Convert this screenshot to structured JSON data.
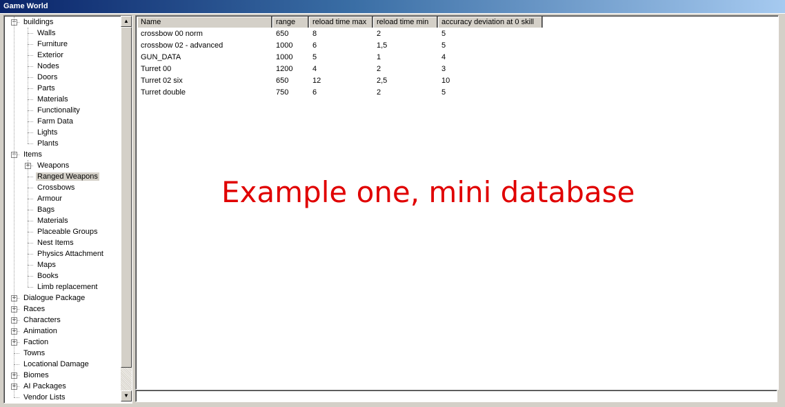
{
  "window": {
    "title": "Game World"
  },
  "tree": {
    "items": [
      {
        "label": "buildings",
        "level": 0,
        "expander": "minus"
      },
      {
        "label": "Walls",
        "level": 1
      },
      {
        "label": "Furniture",
        "level": 1
      },
      {
        "label": "Exterior",
        "level": 1
      },
      {
        "label": "Nodes",
        "level": 1
      },
      {
        "label": "Doors",
        "level": 1
      },
      {
        "label": "Parts",
        "level": 1
      },
      {
        "label": "Materials",
        "level": 1
      },
      {
        "label": "Functionality",
        "level": 1
      },
      {
        "label": "Farm Data",
        "level": 1
      },
      {
        "label": "Lights",
        "level": 1
      },
      {
        "label": "Plants",
        "level": 1
      },
      {
        "label": "Items",
        "level": 0,
        "expander": "minus"
      },
      {
        "label": "Weapons",
        "level": 1,
        "expander": "plus"
      },
      {
        "label": "Ranged Weapons",
        "level": 1,
        "selected": true
      },
      {
        "label": "Crossbows",
        "level": 1
      },
      {
        "label": "Armour",
        "level": 1
      },
      {
        "label": "Bags",
        "level": 1
      },
      {
        "label": "Materials",
        "level": 1
      },
      {
        "label": "Placeable Groups",
        "level": 1
      },
      {
        "label": "Nest Items",
        "level": 1
      },
      {
        "label": "Physics Attachment",
        "level": 1
      },
      {
        "label": "Maps",
        "level": 1
      },
      {
        "label": "Books",
        "level": 1
      },
      {
        "label": "Limb replacement",
        "level": 1
      },
      {
        "label": "Dialogue Package",
        "level": 0,
        "expander": "plus"
      },
      {
        "label": "Races",
        "level": 0,
        "expander": "plus"
      },
      {
        "label": "Characters",
        "level": 0,
        "expander": "plus"
      },
      {
        "label": "Animation",
        "level": 0,
        "expander": "plus"
      },
      {
        "label": "Faction",
        "level": 0,
        "expander": "plus"
      },
      {
        "label": "Towns",
        "level": 0
      },
      {
        "label": "Locational Damage",
        "level": 0
      },
      {
        "label": "Biomes",
        "level": 0,
        "expander": "plus"
      },
      {
        "label": "AI Packages",
        "level": 0,
        "expander": "plus"
      },
      {
        "label": "Vendor Lists",
        "level": 0
      }
    ]
  },
  "grid": {
    "columns": [
      "Name",
      "range",
      "reload time max",
      "reload time min",
      "accuracy deviation at 0 skill"
    ],
    "rows": [
      [
        "crossbow 00 norm",
        "650",
        "8",
        "2",
        "5"
      ],
      [
        "crossbow 02 - advanced",
        "1000",
        "6",
        "1,5",
        "5"
      ],
      [
        "GUN_DATA",
        "1000",
        "5",
        "1",
        "4"
      ],
      [
        "Turret 00",
        "1200",
        "4",
        "2",
        "3"
      ],
      [
        "Turret 02 six",
        "650",
        "12",
        "2,5",
        "10"
      ],
      [
        "Turret double",
        "750",
        "6",
        "2",
        "5"
      ]
    ]
  },
  "overlay": {
    "text": "Example one, mini database",
    "color": "#e00000"
  },
  "icons": {
    "scroll_up": "arrow-up-icon",
    "scroll_down": "arrow-down-icon",
    "expand": "plus-box-icon",
    "collapse": "minus-box-icon"
  }
}
